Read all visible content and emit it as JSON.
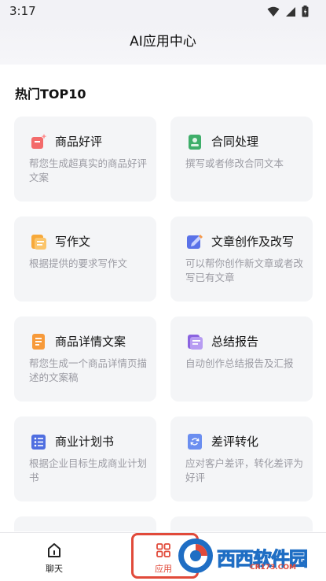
{
  "status_bar": {
    "time": "3:17"
  },
  "header": {
    "title": "AI应用中心"
  },
  "section": {
    "title": "热门TOP10"
  },
  "cards": [
    {
      "title": "商品好评",
      "desc": "帮您生成超真实的商品好评文案",
      "icon": "review-icon"
    },
    {
      "title": "合同处理",
      "desc": "撰写或者修改合同文本",
      "icon": "contract-icon"
    },
    {
      "title": "写作文",
      "desc": "根据提供的要求写作文",
      "icon": "essay-icon"
    },
    {
      "title": "文章创作及改写",
      "desc": "可以帮你创作新文章或者改写已有文章",
      "icon": "pen-icon"
    },
    {
      "title": "商品详情文案",
      "desc": "帮您生成一个商品详情页描述的文案稿",
      "icon": "product-doc-icon"
    },
    {
      "title": "总结报告",
      "desc": "自动创作总结报告及汇报",
      "icon": "report-icon"
    },
    {
      "title": "商业计划书",
      "desc": "根据企业目标生成商业计划书",
      "icon": "plan-icon"
    },
    {
      "title": "差评转化",
      "desc": "应对客户差评，转化差评为好评",
      "icon": "convert-icon"
    },
    {
      "title": "",
      "desc": "",
      "icon": ""
    },
    {
      "title": "",
      "desc": "",
      "icon": ""
    }
  ],
  "nav": {
    "chat_label": "聊天",
    "apps_label": "应用"
  },
  "watermark": {
    "text": "西西软件园",
    "url": "CR173.COM"
  },
  "colors": {
    "card_bg": "#f4f5f7",
    "accent_red": "#e14a3a",
    "text_secondary": "#9b9ba3"
  }
}
